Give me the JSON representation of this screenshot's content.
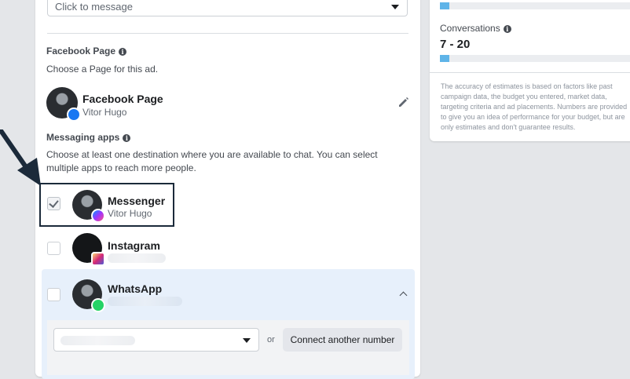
{
  "cta_select": {
    "value": "Click to message"
  },
  "facebook_page": {
    "title": "Facebook Page",
    "helper": "Choose a Page for this ad.",
    "selected_name": "Facebook Page",
    "selected_sub": "Vitor Hugo",
    "edit_icon": "pencil-icon"
  },
  "messaging_apps": {
    "title": "Messaging apps",
    "helper": "Choose at least one destination where you are available to chat. You can select multiple apps to reach more people.",
    "apps": [
      {
        "name": "Messenger",
        "sub": "Vitor Hugo",
        "checked": true,
        "icon": "messenger-icon"
      },
      {
        "name": "Instagram",
        "sub": "",
        "checked": false,
        "icon": "instagram-icon"
      },
      {
        "name": "WhatsApp",
        "sub": "",
        "checked": false,
        "icon": "whatsapp-icon"
      }
    ],
    "whatsapp": {
      "or_label": "or",
      "connect_label": "Connect another number"
    }
  },
  "estimates": {
    "top_bar_fraction": 0.05,
    "conversations_label": "Conversations",
    "conversations_value": "7 - 20",
    "conversations_bar_fraction": 0.05,
    "disclaimer": "The accuracy of estimates is based on factors like past campaign data, the budget you entered, market data, targeting criteria and ad placements. Numbers are provided to give you an idea of performance for your budget, but are only estimates and don't guarantee results."
  },
  "colors": {
    "accent": "#1877f2",
    "bar_fill": "#5fb4e8",
    "highlight_border": "#1b2a3a",
    "arrow": "#1b2a3a"
  }
}
